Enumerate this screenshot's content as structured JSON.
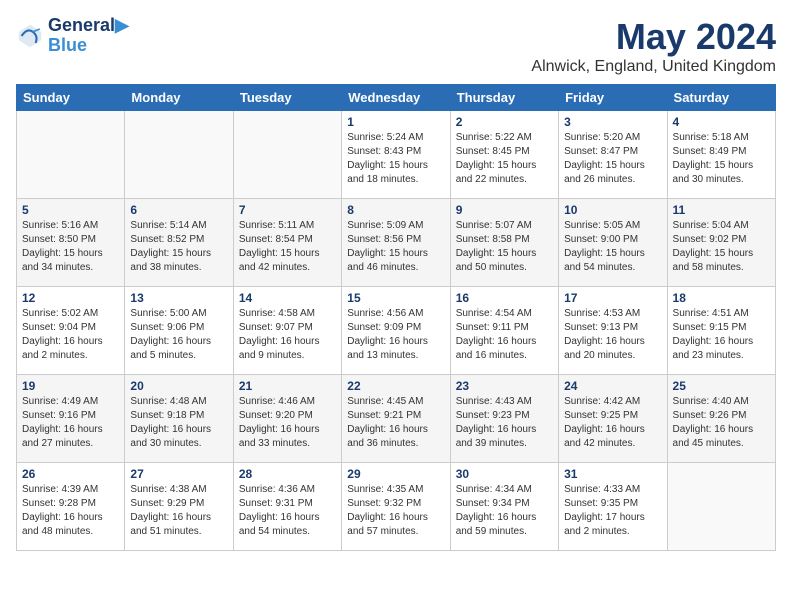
{
  "header": {
    "logo_line1": "General",
    "logo_line2": "Blue",
    "title": "May 2024",
    "subtitle": "Alnwick, England, United Kingdom"
  },
  "weekdays": [
    "Sunday",
    "Monday",
    "Tuesday",
    "Wednesday",
    "Thursday",
    "Friday",
    "Saturday"
  ],
  "weeks": [
    [
      {
        "day": "",
        "info": ""
      },
      {
        "day": "",
        "info": ""
      },
      {
        "day": "",
        "info": ""
      },
      {
        "day": "1",
        "info": "Sunrise: 5:24 AM\nSunset: 8:43 PM\nDaylight: 15 hours\nand 18 minutes."
      },
      {
        "day": "2",
        "info": "Sunrise: 5:22 AM\nSunset: 8:45 PM\nDaylight: 15 hours\nand 22 minutes."
      },
      {
        "day": "3",
        "info": "Sunrise: 5:20 AM\nSunset: 8:47 PM\nDaylight: 15 hours\nand 26 minutes."
      },
      {
        "day": "4",
        "info": "Sunrise: 5:18 AM\nSunset: 8:49 PM\nDaylight: 15 hours\nand 30 minutes."
      }
    ],
    [
      {
        "day": "5",
        "info": "Sunrise: 5:16 AM\nSunset: 8:50 PM\nDaylight: 15 hours\nand 34 minutes."
      },
      {
        "day": "6",
        "info": "Sunrise: 5:14 AM\nSunset: 8:52 PM\nDaylight: 15 hours\nand 38 minutes."
      },
      {
        "day": "7",
        "info": "Sunrise: 5:11 AM\nSunset: 8:54 PM\nDaylight: 15 hours\nand 42 minutes."
      },
      {
        "day": "8",
        "info": "Sunrise: 5:09 AM\nSunset: 8:56 PM\nDaylight: 15 hours\nand 46 minutes."
      },
      {
        "day": "9",
        "info": "Sunrise: 5:07 AM\nSunset: 8:58 PM\nDaylight: 15 hours\nand 50 minutes."
      },
      {
        "day": "10",
        "info": "Sunrise: 5:05 AM\nSunset: 9:00 PM\nDaylight: 15 hours\nand 54 minutes."
      },
      {
        "day": "11",
        "info": "Sunrise: 5:04 AM\nSunset: 9:02 PM\nDaylight: 15 hours\nand 58 minutes."
      }
    ],
    [
      {
        "day": "12",
        "info": "Sunrise: 5:02 AM\nSunset: 9:04 PM\nDaylight: 16 hours\nand 2 minutes."
      },
      {
        "day": "13",
        "info": "Sunrise: 5:00 AM\nSunset: 9:06 PM\nDaylight: 16 hours\nand 5 minutes."
      },
      {
        "day": "14",
        "info": "Sunrise: 4:58 AM\nSunset: 9:07 PM\nDaylight: 16 hours\nand 9 minutes."
      },
      {
        "day": "15",
        "info": "Sunrise: 4:56 AM\nSunset: 9:09 PM\nDaylight: 16 hours\nand 13 minutes."
      },
      {
        "day": "16",
        "info": "Sunrise: 4:54 AM\nSunset: 9:11 PM\nDaylight: 16 hours\nand 16 minutes."
      },
      {
        "day": "17",
        "info": "Sunrise: 4:53 AM\nSunset: 9:13 PM\nDaylight: 16 hours\nand 20 minutes."
      },
      {
        "day": "18",
        "info": "Sunrise: 4:51 AM\nSunset: 9:15 PM\nDaylight: 16 hours\nand 23 minutes."
      }
    ],
    [
      {
        "day": "19",
        "info": "Sunrise: 4:49 AM\nSunset: 9:16 PM\nDaylight: 16 hours\nand 27 minutes."
      },
      {
        "day": "20",
        "info": "Sunrise: 4:48 AM\nSunset: 9:18 PM\nDaylight: 16 hours\nand 30 minutes."
      },
      {
        "day": "21",
        "info": "Sunrise: 4:46 AM\nSunset: 9:20 PM\nDaylight: 16 hours\nand 33 minutes."
      },
      {
        "day": "22",
        "info": "Sunrise: 4:45 AM\nSunset: 9:21 PM\nDaylight: 16 hours\nand 36 minutes."
      },
      {
        "day": "23",
        "info": "Sunrise: 4:43 AM\nSunset: 9:23 PM\nDaylight: 16 hours\nand 39 minutes."
      },
      {
        "day": "24",
        "info": "Sunrise: 4:42 AM\nSunset: 9:25 PM\nDaylight: 16 hours\nand 42 minutes."
      },
      {
        "day": "25",
        "info": "Sunrise: 4:40 AM\nSunset: 9:26 PM\nDaylight: 16 hours\nand 45 minutes."
      }
    ],
    [
      {
        "day": "26",
        "info": "Sunrise: 4:39 AM\nSunset: 9:28 PM\nDaylight: 16 hours\nand 48 minutes."
      },
      {
        "day": "27",
        "info": "Sunrise: 4:38 AM\nSunset: 9:29 PM\nDaylight: 16 hours\nand 51 minutes."
      },
      {
        "day": "28",
        "info": "Sunrise: 4:36 AM\nSunset: 9:31 PM\nDaylight: 16 hours\nand 54 minutes."
      },
      {
        "day": "29",
        "info": "Sunrise: 4:35 AM\nSunset: 9:32 PM\nDaylight: 16 hours\nand 57 minutes."
      },
      {
        "day": "30",
        "info": "Sunrise: 4:34 AM\nSunset: 9:34 PM\nDaylight: 16 hours\nand 59 minutes."
      },
      {
        "day": "31",
        "info": "Sunrise: 4:33 AM\nSunset: 9:35 PM\nDaylight: 17 hours\nand 2 minutes."
      },
      {
        "day": "",
        "info": ""
      }
    ]
  ]
}
